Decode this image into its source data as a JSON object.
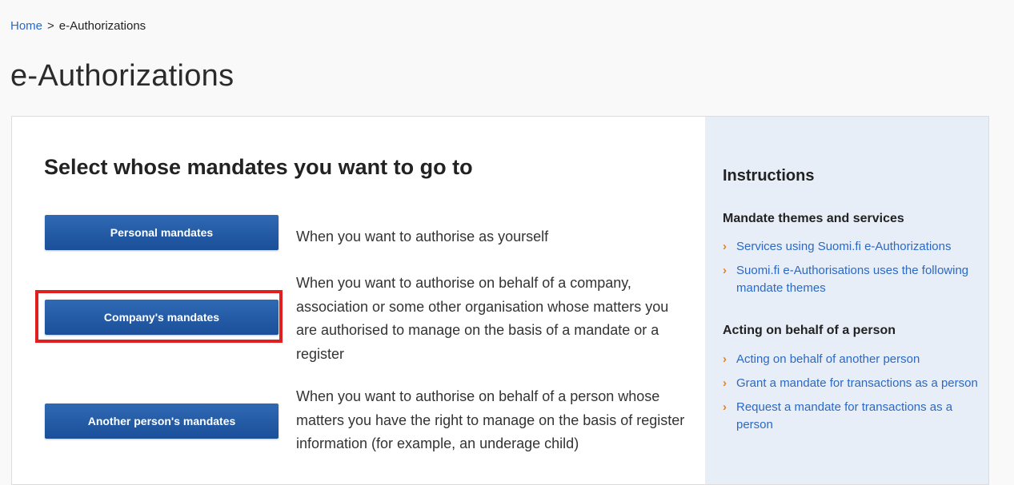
{
  "breadcrumb": {
    "home": "Home",
    "separator": ">",
    "current": "e-Authorizations"
  },
  "page_title": "e-Authorizations",
  "main": {
    "heading": "Select whose mandates you want to go to",
    "options": [
      {
        "button": "Personal mandates",
        "description": "When you want to authorise as yourself"
      },
      {
        "button": "Company's mandates",
        "description": "When you want to authorise on behalf of a company, association or some other organisation whose matters you are authorised to manage on the basis of a mandate or a register"
      },
      {
        "button": "Another person's mandates",
        "description": "When you want to authorise on behalf of a person whose matters you have the right to manage on the basis of register information (for example, an underage child)"
      }
    ]
  },
  "sidebar": {
    "title": "Instructions",
    "sections": [
      {
        "heading": "Mandate themes and services",
        "links": [
          "Services using Suomi.fi e-Authorizations",
          "Suomi.fi e-Authorisations uses the following mandate themes"
        ]
      },
      {
        "heading": "Acting on behalf of a person",
        "links": [
          "Acting on behalf of another person",
          "Grant a mandate for transactions as a person",
          "Request a mandate for transactions as a person"
        ]
      }
    ]
  },
  "colors": {
    "button": "#1f58a3",
    "link": "#2a69c6",
    "chevron": "#e8801a",
    "highlight": "#e02020",
    "sidebar_bg": "#e7eef8"
  },
  "icons": {
    "link_bullet": "chevron-right-icon"
  }
}
